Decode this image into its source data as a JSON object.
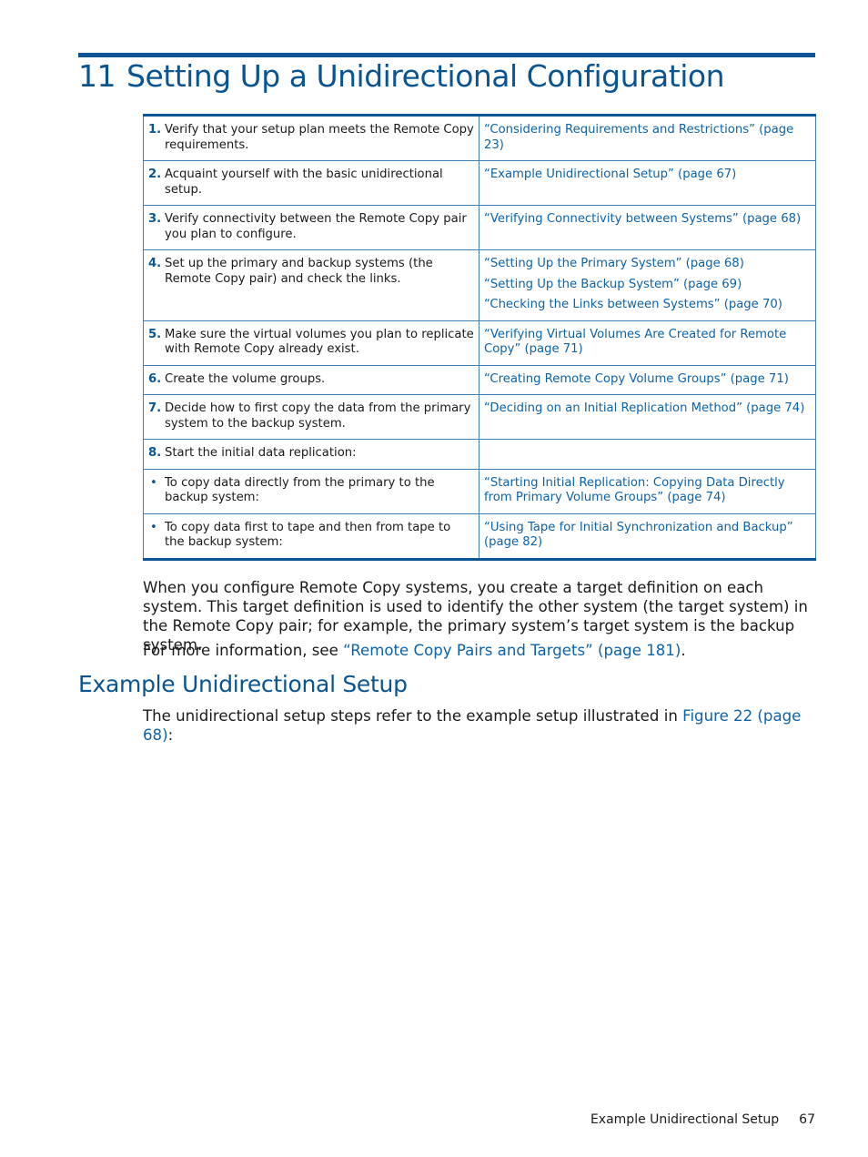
{
  "chapter": {
    "number": "11",
    "title": "Setting Up a Unidirectional Configuration"
  },
  "steps_table": {
    "rows": [
      {
        "num": "1.",
        "text": "Verify that your setup plan meets the Remote Copy requirements.",
        "links": [
          "“Considering Requirements and Restrictions” (page 23)"
        ]
      },
      {
        "num": "2.",
        "text": "Acquaint yourself with the basic unidirectional setup.",
        "links": [
          "“Example Unidirectional Setup” (page 67)"
        ]
      },
      {
        "num": "3.",
        "text": "Verify connectivity between the Remote Copy pair you plan to configure.",
        "links": [
          "“Verifying Connectivity between Systems” (page 68)"
        ]
      },
      {
        "num": "4.",
        "text": "Set up the primary and backup systems (the Remote Copy pair) and check the links.",
        "links": [
          "“Setting Up the Primary System” (page 68)",
          "“Setting Up the Backup System” (page 69)",
          "“Checking the Links between Systems” (page 70)"
        ]
      },
      {
        "num": "5.",
        "text": "Make sure the virtual volumes you plan to replicate with Remote Copy already exist.",
        "links": [
          "“Verifying Virtual Volumes Are Created for Remote Copy” (page 71)"
        ]
      },
      {
        "num": "6.",
        "text": "Create the volume groups.",
        "links": [
          "“Creating Remote Copy Volume Groups” (page 71)"
        ]
      },
      {
        "num": "7.",
        "text": "Decide how to first copy the data from the primary system to the backup system.",
        "links": [
          "“Deciding on an Initial Replication Method” (page 74)"
        ]
      },
      {
        "num": "8.",
        "text": "Start the initial data replication:",
        "links": []
      },
      {
        "num": "•",
        "text": "To copy data directly from the primary to the backup system:",
        "links": [
          "“Starting Initial Replication: Copying Data Directly from Primary Volume Groups” (page 74)"
        ]
      },
      {
        "num": "•",
        "text": "To copy data first to tape and then from tape to the backup system:",
        "links": [
          "“Using Tape for Initial Synchronization and Backup” (page 82)"
        ]
      }
    ]
  },
  "paragraphs": {
    "target_definition": "When you configure Remote Copy systems, you create a target definition on each system. This target definition is used to identify the other system (the target system) in the Remote Copy pair; for example, the primary system’s target system is the backup system.",
    "more_info_prefix": "For more information, see ",
    "more_info_link": "“Remote Copy Pairs and Targets” (page 181)",
    "more_info_suffix": "."
  },
  "section": {
    "title": "Example Unidirectional Setup",
    "intro_prefix": "The unidirectional setup steps refer to the example setup illustrated in ",
    "intro_link": "Figure 22 (page 68)",
    "intro_suffix": ":"
  },
  "footer": {
    "section_name": "Example Unidirectional Setup",
    "page_number": "67"
  }
}
